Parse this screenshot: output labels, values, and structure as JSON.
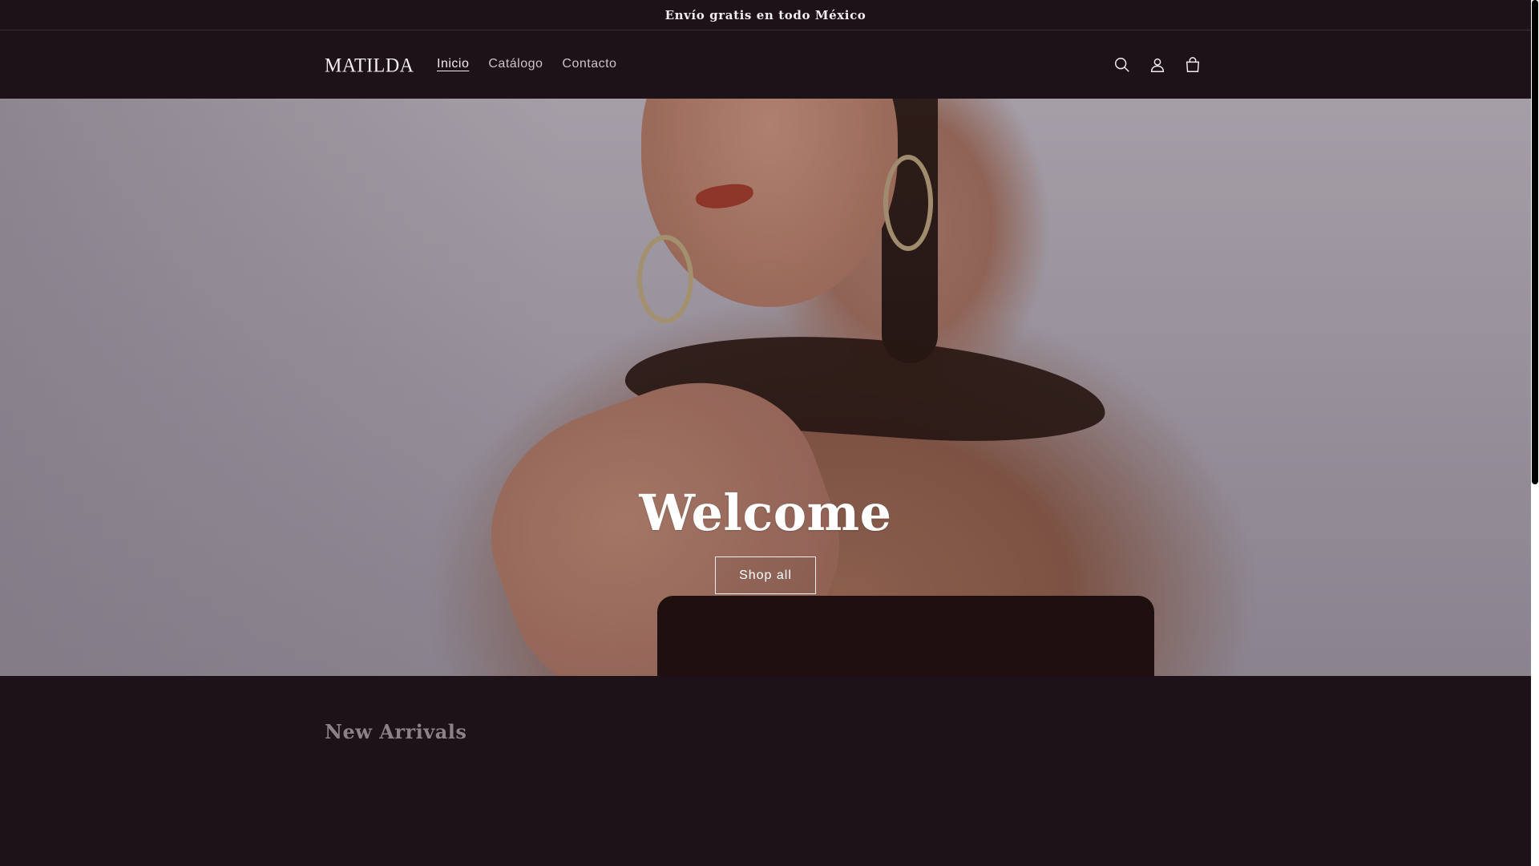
{
  "announcement": {
    "text": "Envío gratis en todo México"
  },
  "header": {
    "logo": "MATILDA",
    "nav": [
      {
        "label": "Inicio",
        "active": true
      },
      {
        "label": "Catálogo",
        "active": false
      },
      {
        "label": "Contacto",
        "active": false
      }
    ],
    "icons": [
      "search-icon",
      "account-icon",
      "cart-icon"
    ]
  },
  "hero": {
    "title": "Welcome",
    "button_label": "Shop all"
  },
  "new_arrivals": {
    "title": "New Arrivals"
  },
  "colors": {
    "background": "#1c1218",
    "text": "#f2ecef",
    "muted_heading": "#8c8189"
  }
}
